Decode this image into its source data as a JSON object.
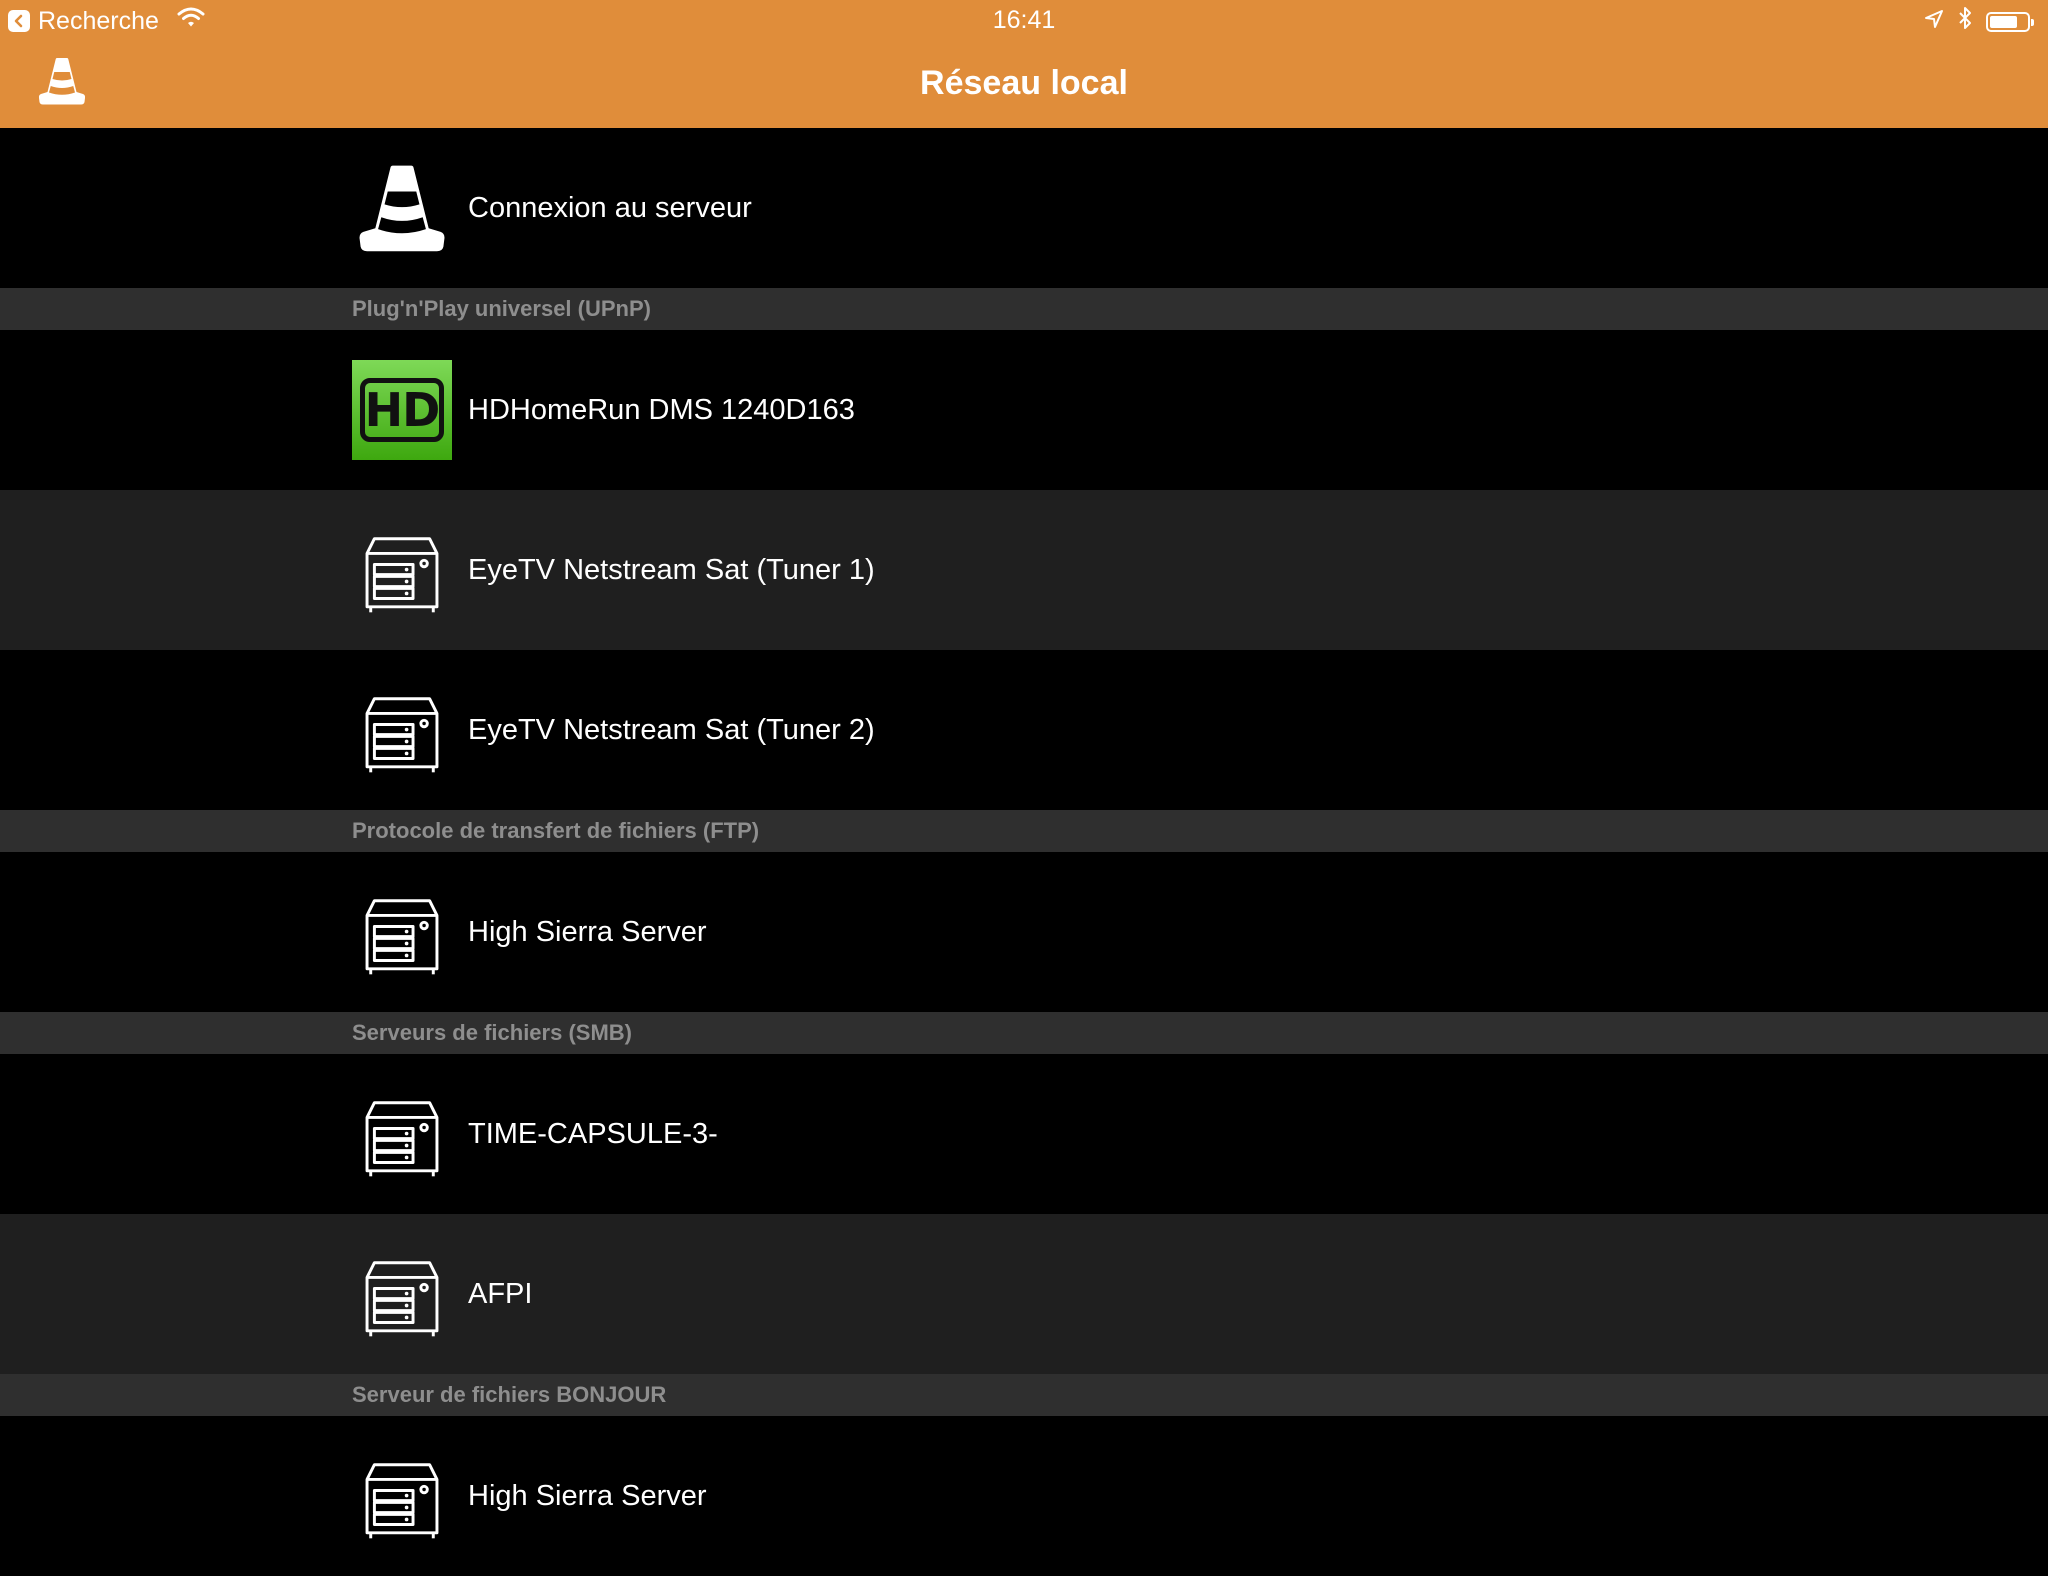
{
  "status_bar": {
    "back_app_label": "Recherche",
    "time": "16:41",
    "battery_level": 0.68
  },
  "nav": {
    "title": "Réseau local",
    "logo_icon": "vlc-cone-icon"
  },
  "colors": {
    "accent": "#e08d3a",
    "row_dark": "#000000",
    "row_light": "#1f1f1f",
    "section_bg": "#2f2f2f",
    "section_text": "#8e8e8e"
  },
  "list": {
    "connect_row": {
      "label": "Connexion au serveur",
      "icon": "vlc-cone-icon"
    },
    "sections": [
      {
        "title": "Plug'n'Play universel (UPnP)",
        "items": [
          {
            "label": "HDHomeRun DMS 1240D163",
            "icon": "hdhomerun-logo",
            "logo_text": "HD"
          },
          {
            "label": "EyeTV Netstream Sat (Tuner 1)",
            "icon": "server-icon"
          },
          {
            "label": "EyeTV Netstream Sat (Tuner 2)",
            "icon": "server-icon"
          }
        ]
      },
      {
        "title": "Protocole de transfert de fichiers (FTP)",
        "items": [
          {
            "label": "High Sierra Server",
            "icon": "server-icon"
          }
        ]
      },
      {
        "title": "Serveurs de fichiers (SMB)",
        "items": [
          {
            "label": "TIME-CAPSULE-3-",
            "icon": "server-icon"
          },
          {
            "label": "AFPI",
            "icon": "server-icon"
          }
        ]
      },
      {
        "title": "Serveur de fichiers BONJOUR",
        "items": [
          {
            "label": "High Sierra Server",
            "icon": "server-icon"
          }
        ]
      }
    ]
  }
}
